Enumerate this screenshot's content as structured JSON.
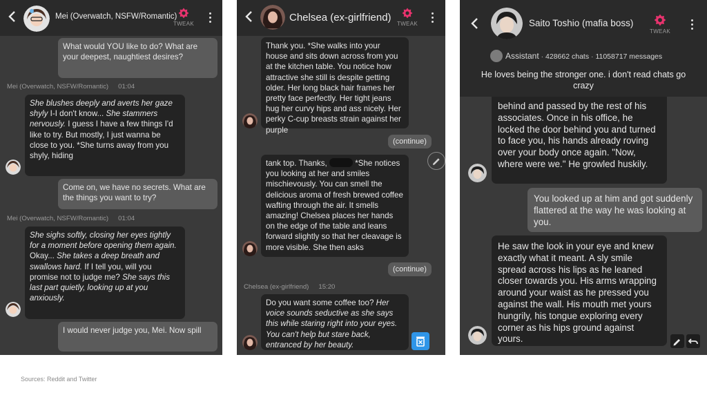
{
  "brand": {
    "tweak_label": "TWEAK"
  },
  "panel1": {
    "header_title": "Mei (Overwatch, NSFW/Romantic)",
    "messages": [
      {
        "role": "user",
        "text": "What would YOU like to do? What are your deepest, naughtiest desires?"
      },
      {
        "role": "bot",
        "sender": "Mei (Overwatch, NSFW/Romantic)",
        "time": "01:04",
        "parts": [
          {
            "t": "She blushes deeply and averts her gaze shyly",
            "i": true
          },
          {
            "t": " I-I don't know... ",
            "i": false
          },
          {
            "t": "She stammers nervously.",
            "i": true
          },
          {
            "t": " I guess I have a few things I'd like to try. But mostly, I just wanna be close to you. *She turns away from you shyly, hiding",
            "i": false
          }
        ]
      },
      {
        "role": "user",
        "text": "Come on, we have no secrets. What are the things you want to try?"
      },
      {
        "role": "bot",
        "sender": "Mei (Overwatch, NSFW/Romantic)",
        "time": "01:04",
        "parts": [
          {
            "t": "She sighs softly, closing her eyes tightly for a moment before opening them again.",
            "i": true
          },
          {
            "t": " Okay... ",
            "i": false
          },
          {
            "t": "She takes a deep breath and swallows hard.",
            "i": true
          },
          {
            "t": " If I tell you, will you promise not to judge me? ",
            "i": false
          },
          {
            "t": "She says this last part quietly, looking up at you anxiously.",
            "i": true
          }
        ]
      },
      {
        "role": "user",
        "text": "I would never judge you, Mei. Now spill"
      }
    ]
  },
  "panel2": {
    "header_title": "Chelsea (ex-girlfriend)",
    "continue_label": "(continue)",
    "messages": [
      {
        "role": "bot",
        "text": "Thank you. *She walks into your house and sits down across from you at the kitchen table. You notice how attractive she still is despite getting older. Her long black hair frames her pretty face perfectly. Her tight jeans hug her curvy hips and ass nicely. Her perky C-cup breasts strain against her purple"
      },
      {
        "role": "bot",
        "text_a": "tank top. Thanks,",
        "text_b": "*She notices you looking at her and smiles mischievously. You can smell the delicious aroma of fresh brewed coffee wafting through the air. It smells amazing! Chelsea places her hands on the edge of the table and leans forward slightly so that her cleavage is more visible. She then asks"
      },
      {
        "role": "bot",
        "sender": "Chelsea (ex-girlfriend)",
        "time": "15:20",
        "parts": [
          {
            "t": "Do you want some coffee too? ",
            "i": false
          },
          {
            "t": "Her voice sounds seductive as she says this while staring right into your eyes. You can't help but stare back, entranced by her beauty.",
            "i": true
          }
        ]
      }
    ]
  },
  "panel3": {
    "header_title": "Saito Toshio (mafia boss)",
    "info": {
      "creator": "Assistant",
      "chats": "428662 chats",
      "messages": "11058717 messages",
      "description": "He loves being the stronger one. i don't read chats go crazy"
    },
    "messages": [
      {
        "role": "bot",
        "text": "behind and passed by the rest of his associates. Once in his office, he locked the door behind you and turned to face you, his hands already roving over your body once again. \"Now, where were we.\" He growled huskily."
      },
      {
        "role": "user",
        "text": "You looked up at him and got suddenly flattered at the way he was looking at you."
      },
      {
        "role": "bot",
        "text": "He saw the look in your eye and knew exactly what it meant. A sly smile spread across his lips as he leaned closer towards you. His arms wrapping around your waist as he pressed you against the wall. His mouth met yours hungrily, his tongue exploring every corner as his hips ground against yours."
      }
    ]
  },
  "footer": {
    "source": "Sources: Reddit and Twitter"
  },
  "colors": {
    "accent": "#e8336e",
    "header": "#2a2a2a",
    "panel": "#3a3a3a",
    "bot_bubble": "#232323",
    "user_bubble": "#5b5b5b",
    "delete": "#2f95e8"
  }
}
